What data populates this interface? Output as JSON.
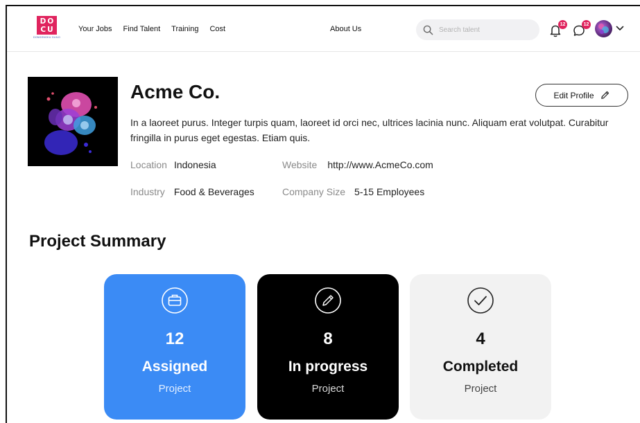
{
  "brand": {
    "logo_text": [
      "DO",
      "CU"
    ],
    "logo_subtext": "DONGENGKU GUILD",
    "color": "#e0245e"
  },
  "nav": {
    "links": [
      "Your Jobs",
      "Find Talent",
      "Training",
      "Cost"
    ],
    "about": "About Us",
    "search_placeholder": "Search talent",
    "notifications_count": "12",
    "messages_count": "12"
  },
  "profile": {
    "name": "Acme Co.",
    "edit_label": "Edit Profile",
    "description": "In a laoreet purus. Integer turpis quam, laoreet id orci nec, ultrices lacinia nunc. Aliquam erat volutpat. Curabitur fringilla in purus eget egestas. Etiam quis.",
    "location_label": "Location",
    "location": "Indonesia",
    "website_label": "Website",
    "website": "http://www.AcmeCo.com",
    "industry_label": "Industry",
    "industry": "Food & Beverages",
    "size_label": "Company Size",
    "size": "5-15 Employees"
  },
  "summary": {
    "title": "Project Summary",
    "cards": [
      {
        "count": "12",
        "label": "Assigned",
        "sub": "Project",
        "icon": "briefcase-icon",
        "color": "#3b8bf5"
      },
      {
        "count": "8",
        "label": "In progress",
        "sub": "Project",
        "icon": "pencil-icon",
        "color": "#000000"
      },
      {
        "count": "4",
        "label": "Completed",
        "sub": "Project",
        "icon": "check-icon",
        "color": "#f2f2f2"
      }
    ]
  }
}
